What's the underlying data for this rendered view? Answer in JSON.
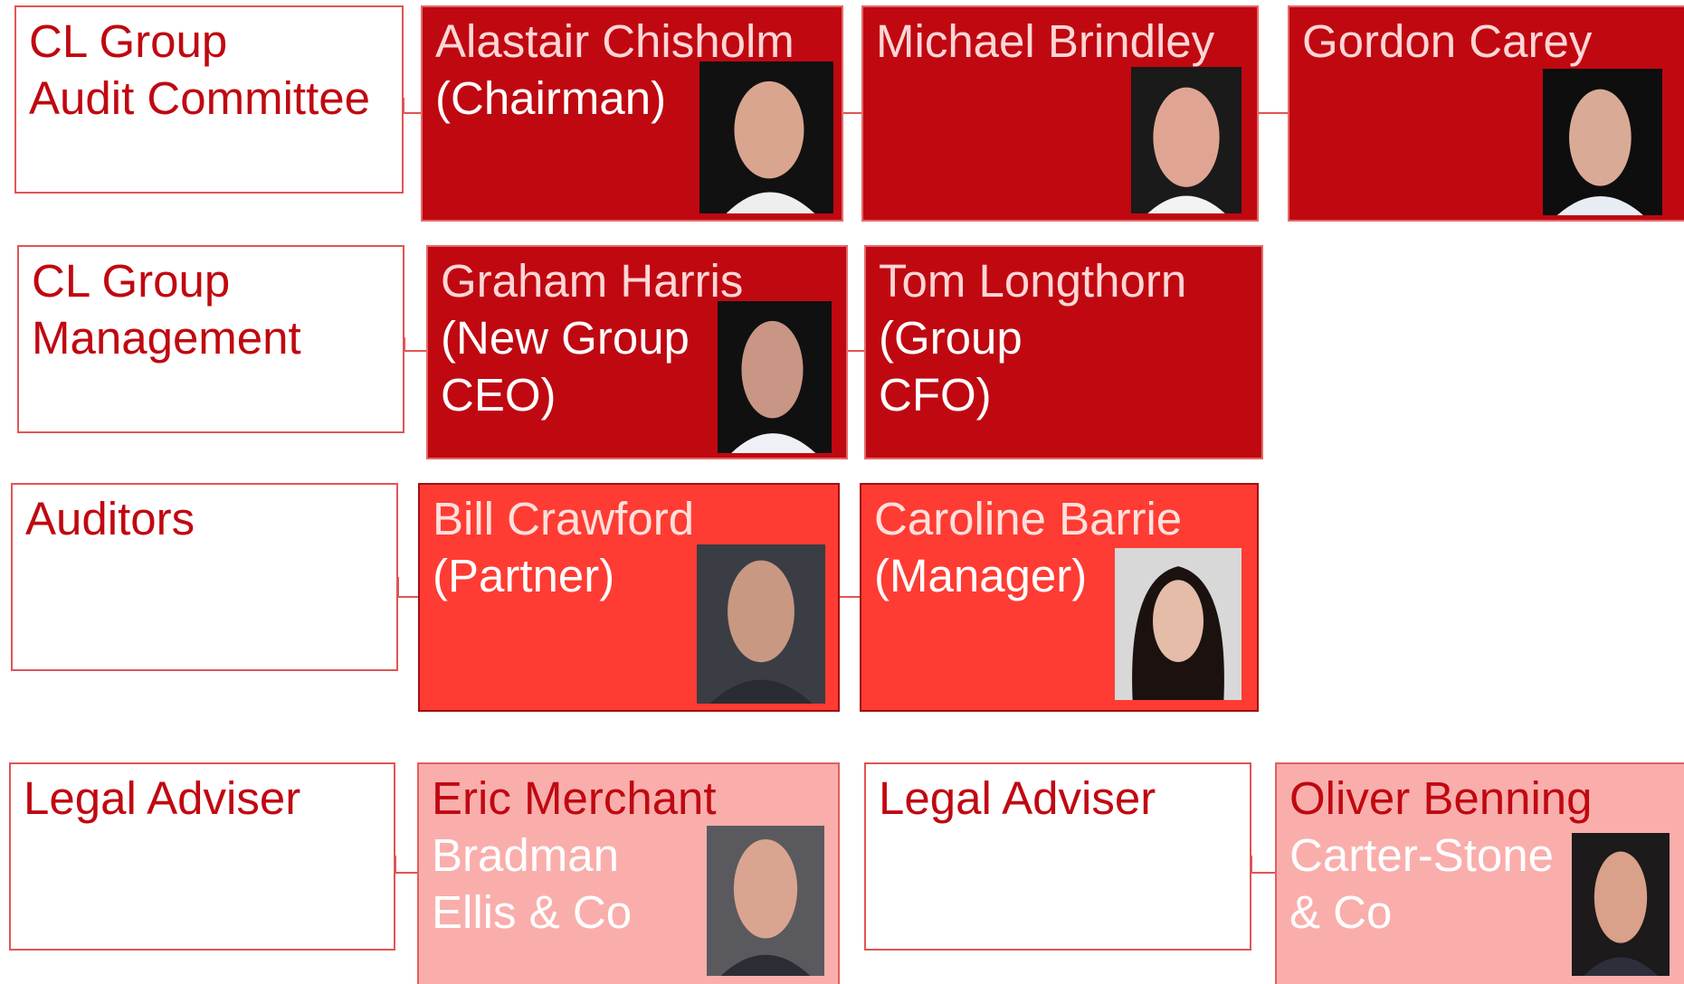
{
  "rows": {
    "audit": {
      "label": [
        "CL Group",
        "Audit Committee"
      ],
      "members": [
        {
          "lines": [
            "Alastair Chisholm",
            "(Chairman)"
          ]
        },
        {
          "lines": [
            "Michael Brindley"
          ]
        },
        {
          "lines": [
            "Gordon Carey"
          ]
        }
      ]
    },
    "management": {
      "label": [
        "CL Group",
        "Management"
      ],
      "members": [
        {
          "lines": [
            "Graham Harris",
            "(New Group",
            "CEO)"
          ]
        },
        {
          "lines": [
            "Tom Longthorn",
            "(Group",
            "CFO)"
          ]
        }
      ]
    },
    "auditors": {
      "label": [
        "Auditors"
      ],
      "members": [
        {
          "lines": [
            "Bill Crawford",
            "(Partner)"
          ]
        },
        {
          "lines": [
            "Caroline Barrie",
            "(Manager)"
          ]
        }
      ]
    },
    "legal": {
      "label_left": [
        "Legal Adviser"
      ],
      "member_left": {
        "lines": [
          "Eric Merchant",
          "Bradman",
          "Ellis & Co"
        ]
      },
      "label_right": [
        "Legal Adviser"
      ],
      "member_right": {
        "lines": [
          "Oliver Benning",
          "Carter-Stone",
          "& Co"
        ]
      }
    }
  },
  "colors": {
    "dark": "#c00811",
    "mid": "#fe3c33",
    "light": "#f9aeac",
    "label_text": "#c00811",
    "connector": "#e05555"
  },
  "icons": [
    "person-photo"
  ]
}
